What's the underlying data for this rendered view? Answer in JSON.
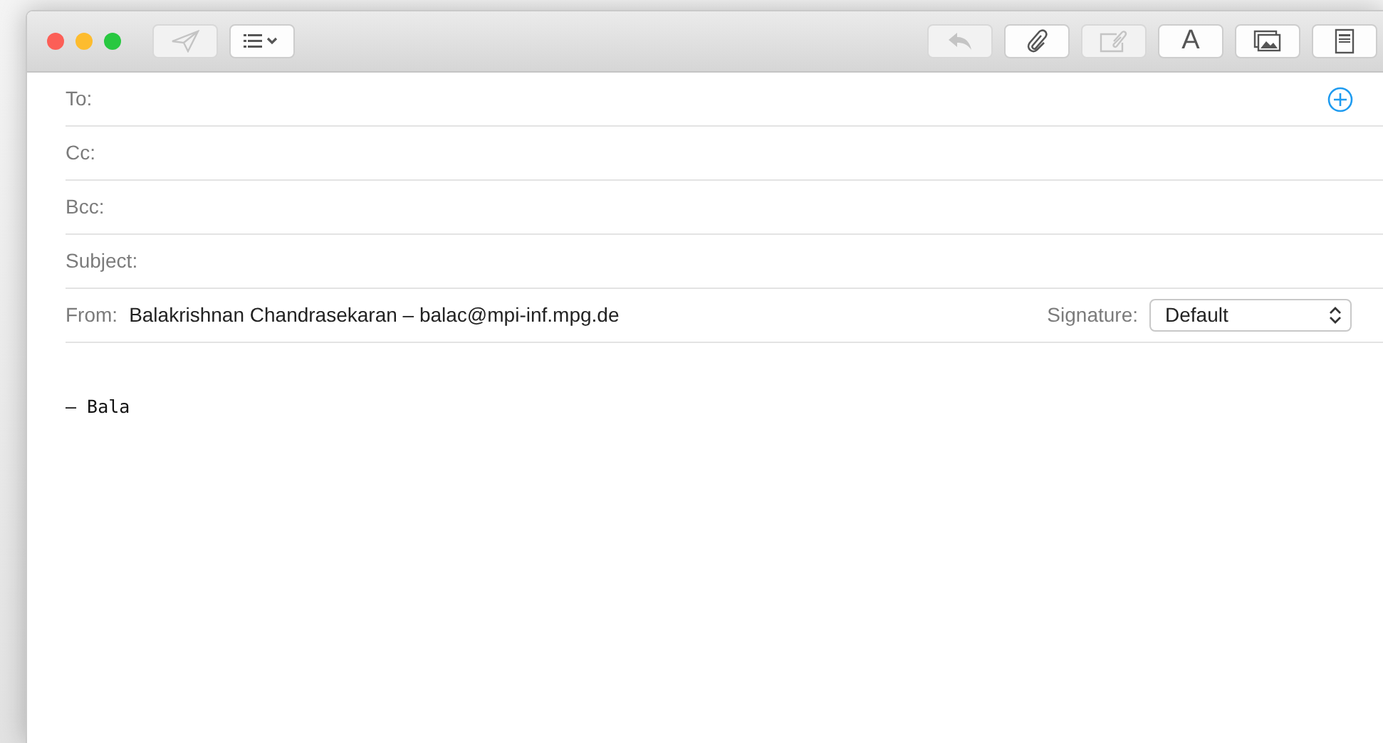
{
  "toolbar_left": [
    {
      "kind": "send",
      "disabled": true
    },
    {
      "kind": "list",
      "disabled": false
    }
  ],
  "toolbar_right": [
    {
      "kind": "reply",
      "disabled": true
    },
    {
      "kind": "attach",
      "disabled": false
    },
    {
      "kind": "markup",
      "disabled": true
    },
    {
      "kind": "font",
      "label": "A",
      "disabled": false
    },
    {
      "kind": "photo",
      "disabled": false
    },
    {
      "kind": "template",
      "disabled": false
    }
  ],
  "fields": [
    {
      "kind": "to",
      "label": "To:"
    },
    {
      "kind": "plain",
      "label": "Cc:"
    },
    {
      "kind": "plain",
      "label": "Bcc:"
    },
    {
      "kind": "plain",
      "label": "Subject:"
    }
  ],
  "from": {
    "label": "From:",
    "value": "Balakrishnan Chandrasekaran – balac@mpi-inf.mpg.de",
    "signature_label": "Signature:",
    "signature": "Default"
  },
  "body": [
    "— Bala"
  ]
}
